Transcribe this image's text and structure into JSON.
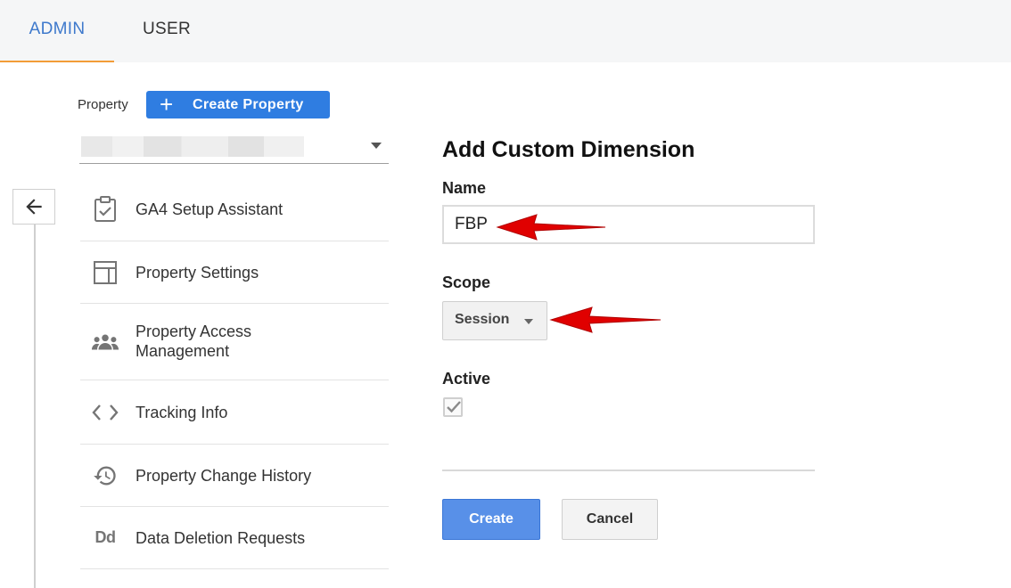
{
  "tabs": [
    {
      "label": "ADMIN",
      "active": true
    },
    {
      "label": "USER",
      "active": false
    }
  ],
  "property": {
    "label": "Property",
    "create_button_label": "Create Property"
  },
  "menu": {
    "items": [
      {
        "label": "GA4 Setup Assistant",
        "icon": "clipboard-check-icon"
      },
      {
        "label": "Property Settings",
        "icon": "layout-icon"
      },
      {
        "label": "Property Access\nManagement",
        "icon": "people-icon"
      },
      {
        "label": "Tracking Info",
        "icon": "code-icon"
      },
      {
        "label": "Property Change History",
        "icon": "history-icon"
      },
      {
        "label": "Data Deletion Requests",
        "icon": "dd-icon",
        "icon_text": "Dd"
      }
    ]
  },
  "form": {
    "title": "Add Custom Dimension",
    "name_label": "Name",
    "name_value": "FBP",
    "scope_label": "Scope",
    "scope_value": "Session",
    "active_label": "Active",
    "active_checked": true,
    "create_label": "Create",
    "cancel_label": "Cancel"
  },
  "colors": {
    "accent_blue": "#2f7de1",
    "active_tab_text": "#3e79cc",
    "active_tab_underline": "#f29c38",
    "annotation_arrow": "#e00000"
  }
}
